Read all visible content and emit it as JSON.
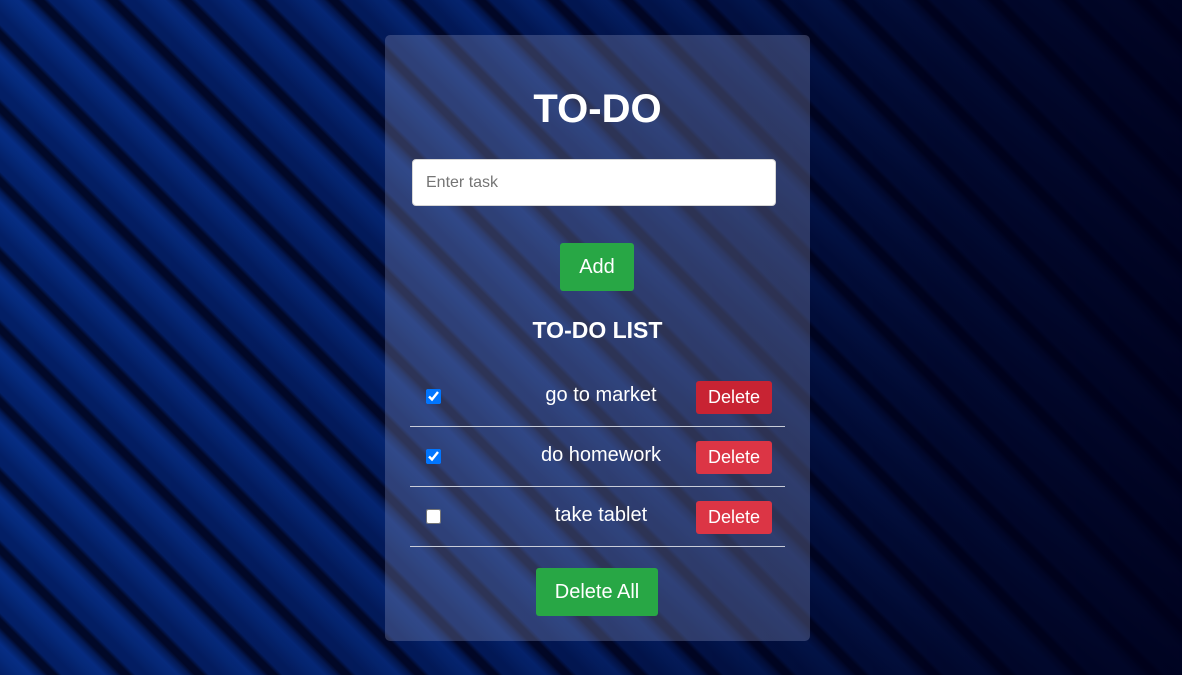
{
  "app": {
    "title": "TO-DO"
  },
  "input": {
    "placeholder": "Enter task",
    "value": ""
  },
  "buttons": {
    "add_label": "Add",
    "delete_all_label": "Delete All"
  },
  "list": {
    "title": "TO-DO LIST",
    "items": [
      {
        "text": "go to market",
        "checked": true,
        "delete_label": "Delete"
      },
      {
        "text": "do homework",
        "checked": true,
        "delete_label": "Delete"
      },
      {
        "text": "take tablet",
        "checked": false,
        "delete_label": "Delete"
      }
    ]
  },
  "colors": {
    "green": "#28a745",
    "red": "#dc3545",
    "checkbox": "#0075ff"
  }
}
